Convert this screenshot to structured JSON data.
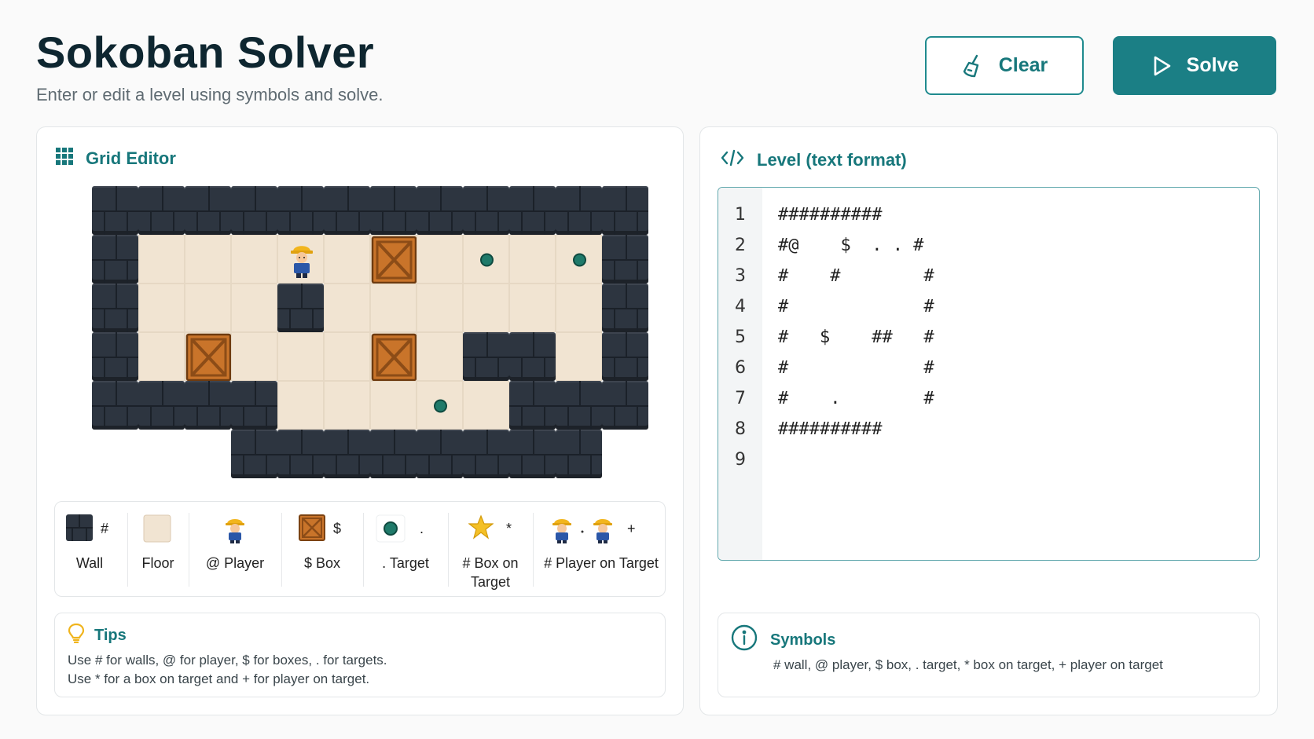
{
  "header": {
    "title": "Sokoban Solver",
    "subtitle": "Enter or edit a level using symbols and solve."
  },
  "actions": {
    "clear_label": "Clear",
    "solve_label": "Solve",
    "clear_icon": "broom-icon",
    "solve_icon": "play-icon"
  },
  "colors": {
    "accent": "#1b7f85",
    "wall": "#2d3540",
    "floor": "#f1e4d2",
    "target": "#1f7a6a",
    "box": "#c9742a"
  },
  "grid_editor": {
    "title": "Grid Editor",
    "icon": "grid-icon",
    "rows": [
      "############",
      "#....@.#..#.#",
      "#.....#.....#",
      "#...#.......#",
      "####.....####",
      "...#######..."
    ],
    "cells": [
      "WWWWWWWWWWWW",
      "WFFF@FBFTFTW",
      "WFFFWFFFFFFW",
      "WFBFFFBFWWFW",
      "WWWWFFFTFWWW",
      "   WWWWWWWW "
    ]
  },
  "legend": [
    {
      "icon": "wall-icon",
      "symbol": "#",
      "label": "Wall"
    },
    {
      "icon": "floor-icon",
      "symbol": "",
      "label": "Floor"
    },
    {
      "icon": "player-icon",
      "symbol": "",
      "label": "@ Player"
    },
    {
      "icon": "box-icon",
      "symbol": "$",
      "label": "$ Box"
    },
    {
      "icon": "target-icon",
      "symbol": ".",
      "label": ". Target"
    },
    {
      "icon": "star-icon",
      "symbol": "*",
      "label": "# Box on Target"
    },
    {
      "icon": "player-on-target-icon",
      "symbol": "+",
      "label": "# Player on Target"
    }
  ],
  "tips": {
    "title": "Tips",
    "icon": "lightbulb-icon",
    "lines": [
      "Use  #  for walls, @ for player, $ for boxes, . for targets.",
      "Use  *  for a box on target and  +  for player on target."
    ]
  },
  "level_text": {
    "title": "Level (text format)",
    "icon": "code-icon",
    "lines": [
      "##########",
      "#@    $  . . #",
      "#    #        #",
      "#             #",
      "#   $    ##   #",
      "#             #",
      "#    .        #",
      "##########",
      ""
    ]
  },
  "symbols": {
    "title": "Symbols",
    "icon": "info-icon",
    "text": "#  wall, @ player, $ box,  .  target,  *  box on target,  +  player on target"
  }
}
